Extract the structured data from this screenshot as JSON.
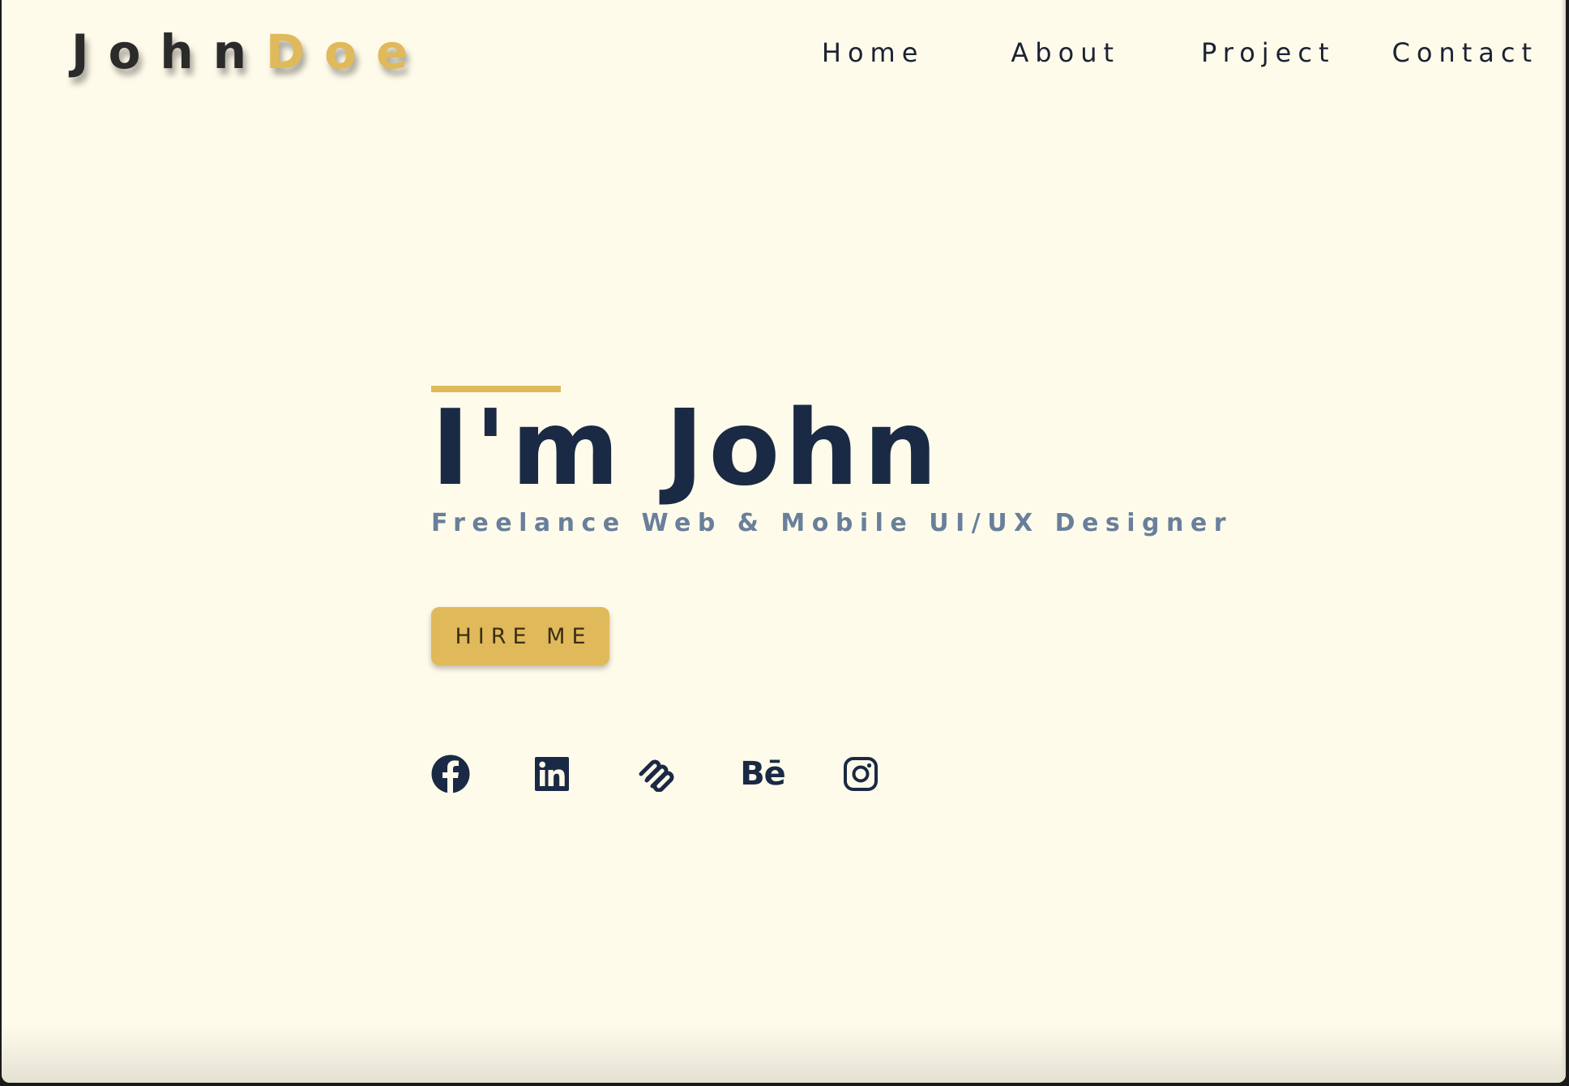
{
  "header": {
    "logo_first": "John",
    "logo_last": "Doe",
    "nav": {
      "home": "Home",
      "about": "About",
      "project": "Project",
      "contact": "Contact"
    }
  },
  "hero": {
    "title": "I'm John",
    "subtitle": "Freelance Web & Mobile UI/UX Designer",
    "cta_label": "HIRE ME"
  },
  "socials": {
    "behance_label": "Bē",
    "icons": [
      "facebook-icon",
      "linkedin-icon",
      "squarespace-icon",
      "behance-icon",
      "instagram-icon"
    ]
  },
  "colors": {
    "background": "#fffbeb",
    "accent": "#e0b95a",
    "navy": "#1a2a44",
    "subtitle": "#697f9b"
  }
}
